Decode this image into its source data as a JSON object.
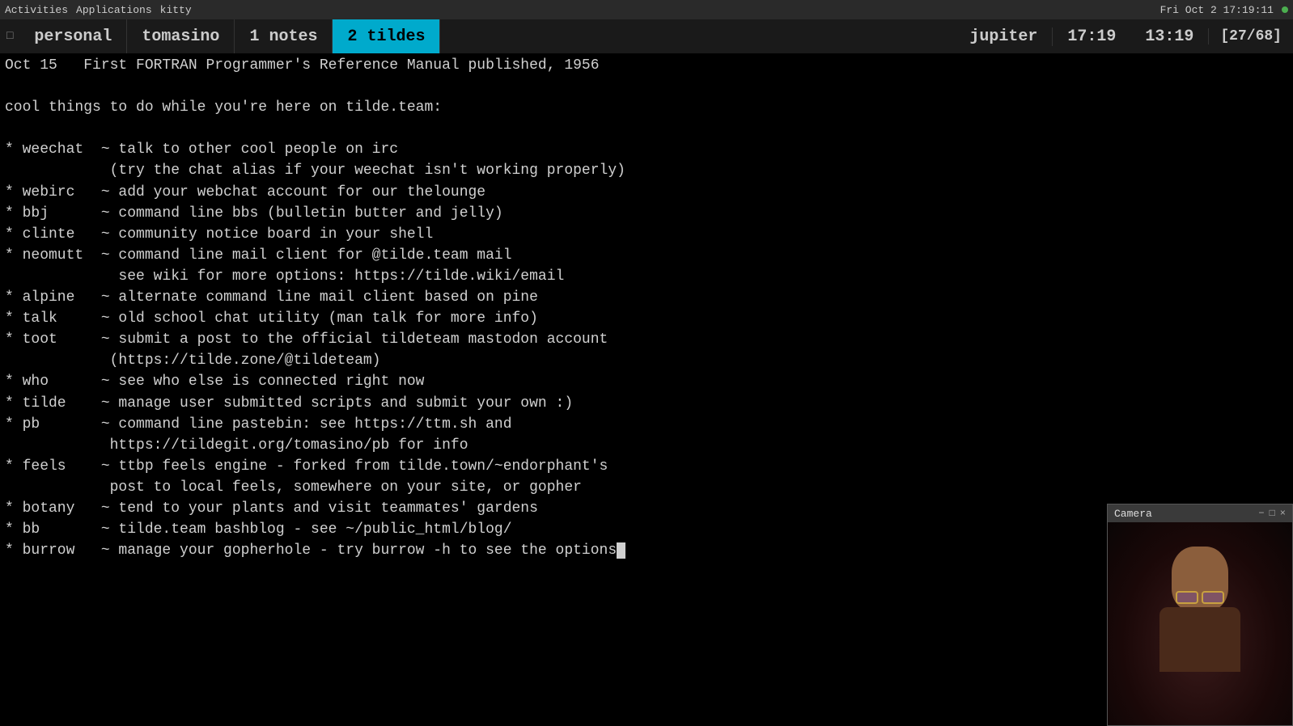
{
  "system_bar": {
    "activities": "Activities",
    "applications": "Applications",
    "kitty": "kitty",
    "datetime": "Fri Oct 2  17:19:11",
    "indicator_color": "#4caf50"
  },
  "tab_bar": {
    "close_symbol": "□",
    "tabs": [
      {
        "id": "personal",
        "label": "personal",
        "active": false
      },
      {
        "id": "tomasino",
        "label": "tomasino",
        "active": false
      },
      {
        "id": "notes",
        "label": "1 notes",
        "active": false
      },
      {
        "id": "tildes",
        "label": "2 tildes",
        "active": true
      },
      {
        "id": "jupiter",
        "label": "jupiter",
        "active": false
      }
    ],
    "time1": "17:19",
    "time2": "13:19",
    "counter": "[27/68]"
  },
  "terminal": {
    "motd_line": "Oct 15   First FORTRAN Programmer's Reference Manual published, 1956",
    "intro": "cool things to do while you're here on tilde.team:",
    "items": [
      {
        "cmd": "weechat",
        "desc": "talk to other cool people on irc",
        "extra": "            (try the chat alias if your weechat isn't working properly)"
      },
      {
        "cmd": "webirc",
        "desc": "add your webchat account for our thelounge",
        "extra": ""
      },
      {
        "cmd": "bbj",
        "desc": "command line bbs (bulletin butter and jelly)",
        "extra": ""
      },
      {
        "cmd": "clinte",
        "desc": "community notice board in your shell",
        "extra": ""
      },
      {
        "cmd": "neomutt",
        "desc": "command line mail client for @tilde.team mail",
        "extra": "             see wiki for more options: https://tilde.wiki/email"
      },
      {
        "cmd": "alpine",
        "desc": "alternate command line mail client based on pine",
        "extra": ""
      },
      {
        "cmd": "talk",
        "desc": "old school chat utility (man talk for more info)",
        "extra": ""
      },
      {
        "cmd": "toot",
        "desc": "submit a post to the official tildeteam mastodon account",
        "extra": "            (https://tilde.zone/@tildeteam)"
      },
      {
        "cmd": "who",
        "desc": "see who else is connected right now",
        "extra": ""
      },
      {
        "cmd": "tilde",
        "desc": "manage user submitted scripts and submit your own :)",
        "extra": ""
      },
      {
        "cmd": "pb",
        "desc": "command line pastebin: see https://ttm.sh and",
        "extra": "            https://tildegit.org/tomasino/pb for info"
      },
      {
        "cmd": "feels",
        "desc": "ttbp feels engine - forked from tilde.town/~endorphant's",
        "extra": "            post to local feels, somewhere on your site, or gopher"
      },
      {
        "cmd": "botany",
        "desc": "tend to your plants and visit teammates' gardens",
        "extra": ""
      },
      {
        "cmd": "bb",
        "desc": "tilde.team bashblog - see ~/public_html/blog/",
        "extra": ""
      },
      {
        "cmd": "burrow",
        "desc": "manage your gopherhole - try burrow -h to see the options",
        "extra": "",
        "cursor": true
      }
    ]
  },
  "camera": {
    "title": "Camera",
    "btn_minimize": "−",
    "btn_maximize": "□",
    "btn_close": "×"
  }
}
